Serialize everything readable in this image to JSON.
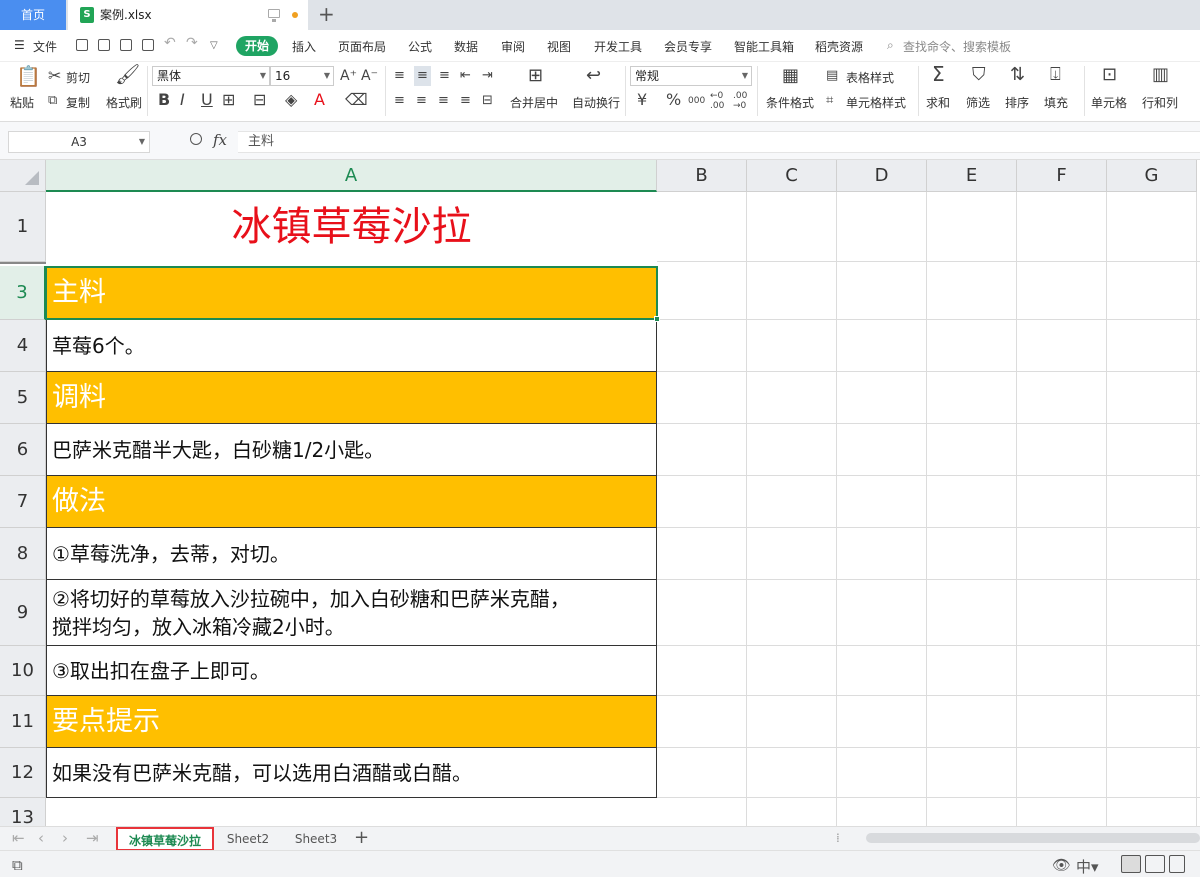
{
  "tabs": {
    "home": "首页",
    "file": "案例.xlsx",
    "file_icon": "S"
  },
  "menu": {
    "file": "文件",
    "start": "开始",
    "items": [
      "插入",
      "页面布局",
      "公式",
      "数据",
      "审阅",
      "视图",
      "开发工具",
      "会员专享",
      "智能工具箱",
      "稻壳资源"
    ],
    "search": "查找命令、搜索模板"
  },
  "ribbon": {
    "paste": "粘贴",
    "cut": "剪切",
    "copy": "复制",
    "format_painter": "格式刷",
    "font_name": "黑体",
    "font_size": "16",
    "merge_center": "合并居中",
    "wrap": "自动换行",
    "number_format": "常规",
    "conditional_format": "条件格式",
    "table_style": "表格样式",
    "cell_style": "单元格样式",
    "sum": "求和",
    "filter": "筛选",
    "sort": "排序",
    "fill": "填充",
    "cell": "单元格",
    "rowcol": "行和列"
  },
  "formula_bar": {
    "name_box": "A3",
    "fx": "fx",
    "value": "主料"
  },
  "columns": [
    "A",
    "B",
    "C",
    "D",
    "E",
    "F",
    "G"
  ],
  "rows": [
    {
      "num": "1",
      "text": "冰镇草莓沙拉",
      "style": "title"
    },
    {
      "num": "3",
      "text": "主料",
      "style": "header"
    },
    {
      "num": "4",
      "text": "草莓6个。",
      "style": "body"
    },
    {
      "num": "5",
      "text": "调料",
      "style": "header"
    },
    {
      "num": "6",
      "text": "巴萨米克醋半大匙，白砂糖1/2小匙。",
      "style": "body"
    },
    {
      "num": "7",
      "text": "做法",
      "style": "header"
    },
    {
      "num": "8",
      "text": "①草莓洗净，去蒂，对切。",
      "style": "body"
    },
    {
      "num": "9",
      "text": "②将切好的草莓放入沙拉碗中，加入白砂糖和巴萨米克醋，\n搅拌均匀，放入冰箱冷藏2小时。",
      "style": "body"
    },
    {
      "num": "10",
      "text": "③取出扣在盘子上即可。",
      "style": "body"
    },
    {
      "num": "11",
      "text": "要点提示",
      "style": "header"
    },
    {
      "num": "12",
      "text": "如果没有巴萨米克醋，可以选用白酒醋或白醋。",
      "style": "body"
    },
    {
      "num": "13",
      "text": "",
      "style": "empty"
    }
  ],
  "sheets": [
    "冰镇草莓沙拉",
    "Sheet2",
    "Sheet3"
  ],
  "colors": {
    "header_fill": "#ffbf00",
    "title_red": "#e8101a",
    "accent_green": "#1d8a52",
    "home_blue": "#4a8ef0"
  }
}
